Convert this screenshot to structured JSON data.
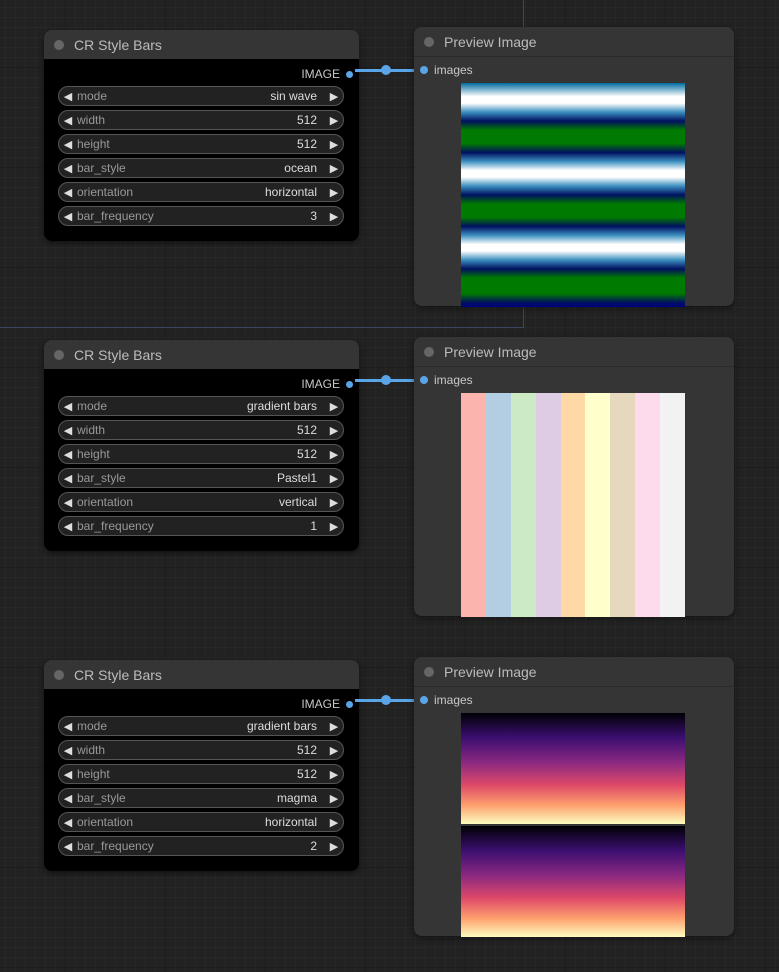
{
  "nodes": [
    {
      "title": "CR Style Bars",
      "output_label": "IMAGE",
      "widgets": [
        {
          "label": "mode",
          "value": "sin wave"
        },
        {
          "label": "width",
          "value": "512"
        },
        {
          "label": "height",
          "value": "512"
        },
        {
          "label": "bar_style",
          "value": "ocean"
        },
        {
          "label": "orientation",
          "value": "horizontal"
        },
        {
          "label": "bar_frequency",
          "value": "3"
        }
      ],
      "preview": {
        "title": "Preview Image",
        "input_label": "images",
        "image": "ocean horizontal sin wave bars"
      }
    },
    {
      "title": "CR Style Bars",
      "output_label": "IMAGE",
      "widgets": [
        {
          "label": "mode",
          "value": "gradient bars"
        },
        {
          "label": "width",
          "value": "512"
        },
        {
          "label": "height",
          "value": "512"
        },
        {
          "label": "bar_style",
          "value": "Pastel1"
        },
        {
          "label": "orientation",
          "value": "vertical"
        },
        {
          "label": "bar_frequency",
          "value": "1"
        }
      ],
      "preview": {
        "title": "Preview Image",
        "input_label": "images",
        "image": "Pastel1 vertical bars",
        "colors": [
          "#fbb4ae",
          "#b3cde3",
          "#ccebc5",
          "#decbe4",
          "#fed9a6",
          "#ffffcc",
          "#e5d8bd",
          "#fddaec",
          "#f2f2f2"
        ]
      }
    },
    {
      "title": "CR Style Bars",
      "output_label": "IMAGE",
      "widgets": [
        {
          "label": "mode",
          "value": "gradient bars"
        },
        {
          "label": "width",
          "value": "512"
        },
        {
          "label": "height",
          "value": "512"
        },
        {
          "label": "bar_style",
          "value": "magma"
        },
        {
          "label": "orientation",
          "value": "horizontal"
        },
        {
          "label": "bar_frequency",
          "value": "2"
        }
      ],
      "preview": {
        "title": "Preview Image",
        "input_label": "images",
        "image": "magma horizontal gradient bars"
      }
    }
  ],
  "colors": {
    "link": "#5aa5e8",
    "node_body": "#000000",
    "node_title": "#353535",
    "canvas": "#222222"
  },
  "icons": {
    "left_arrow": "◀",
    "right_arrow": "▶"
  }
}
